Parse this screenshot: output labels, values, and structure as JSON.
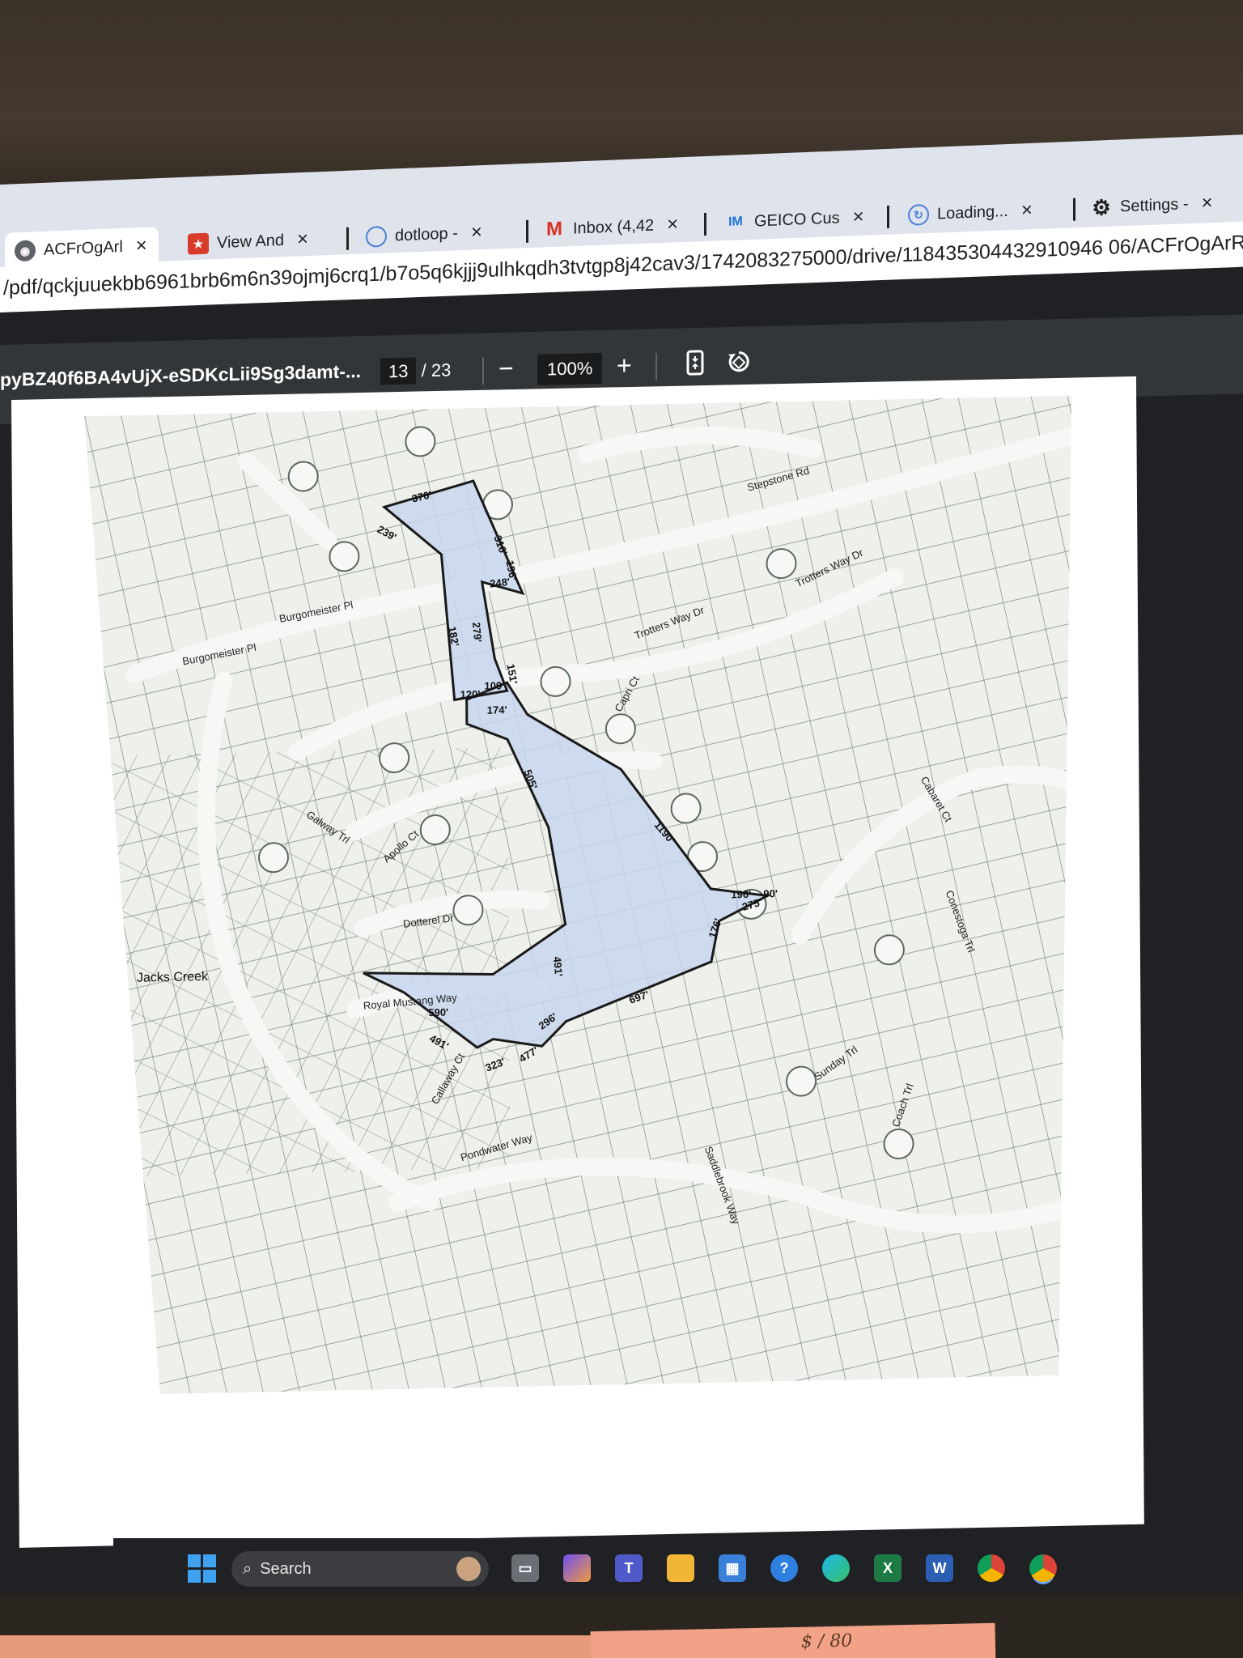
{
  "tabs": [
    {
      "title": "ACFrOgArl",
      "active": true,
      "favicon": "globe-icon"
    },
    {
      "title": "View And",
      "active": false,
      "favicon": "app-icon"
    },
    {
      "title": "dotloop -",
      "active": false,
      "favicon": "dotloop-icon"
    },
    {
      "title": "Inbox (4,42",
      "active": false,
      "favicon": "gmail-icon"
    },
    {
      "title": "GEICO Cus",
      "active": false,
      "favicon": "geico-icon"
    },
    {
      "title": "Loading...",
      "active": false,
      "favicon": "loading-icon"
    },
    {
      "title": "Settings -",
      "active": false,
      "favicon": "gear-icon"
    }
  ],
  "close_glyph": "×",
  "address": {
    "url": "/pdf/qckjuuekbb6961brb6m6n39ojmj6crq1/b7o5q6kjjj9ulhkqdh3tvtgp8j42cav3/1742083275000/drive/118435304432910946 06/ACFrOgArRaFplX"
  },
  "pdf_toolbar": {
    "filename": "pyBZ40f6BA4vUjX-eSDKcLii9Sg3damt-...",
    "current_page": "13",
    "total_pages": "/ 23",
    "zoom": "100%",
    "zoom_out": "−",
    "zoom_in": "+"
  },
  "map": {
    "segment_labels": [
      "376'",
      "239'",
      "316'",
      "248'",
      "196'",
      "279'",
      "182'",
      "120'",
      "109'",
      "151'",
      "174'",
      "505'",
      "1190'",
      "491'",
      "196'",
      "90'",
      "275'",
      "176'",
      "296'",
      "590'",
      "491'",
      "697'",
      "323'",
      "477'"
    ],
    "street_labels": [
      "Jacks Creek",
      "Burgomeister Pl",
      "Burgomeister Pl",
      "Stepstone Rd",
      "Trotters Way Dr",
      "Trotters Way Dr",
      "Capri Ct",
      "Apollo Ct",
      "Galway Trl",
      "Cabaret Ct",
      "Royal Mustang Way",
      "Dotterel Dr",
      "Conestoga Trl",
      "Callaway Ct",
      "Pondwater Way",
      "Saddlebrook Way",
      "Sunday Trl",
      "Coach Trl"
    ],
    "fill_color": "#c8d6ee",
    "boundary_color": "#1a1a1a"
  },
  "taskbar": {
    "search_placeholder": "Search",
    "apps": [
      {
        "icon": "start-icon"
      },
      {
        "icon": "file-explorer-icon"
      },
      {
        "icon": "copilot-icon"
      },
      {
        "icon": "teams-icon"
      },
      {
        "icon": "folder-icon"
      },
      {
        "icon": "store-icon"
      },
      {
        "icon": "help-icon"
      },
      {
        "icon": "edge-icon"
      },
      {
        "icon": "excel-icon",
        "letter": "X"
      },
      {
        "icon": "word-icon",
        "letter": "W"
      },
      {
        "icon": "chrome-icon"
      },
      {
        "icon": "chrome-profile-icon"
      }
    ]
  },
  "sticky_note": {
    "text": "$ / 80"
  }
}
